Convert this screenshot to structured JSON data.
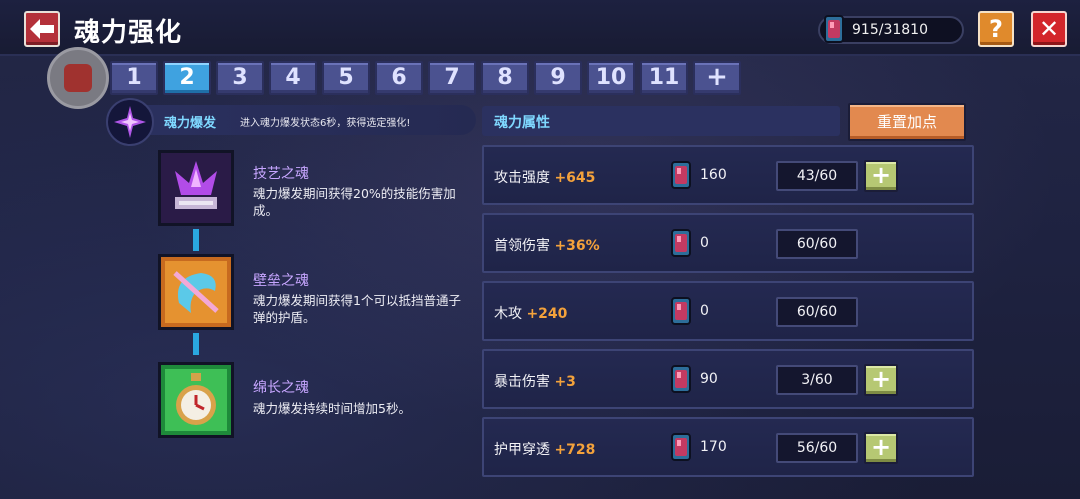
{
  "header": {
    "title": "魂力强化",
    "currency": "915/31810",
    "help_label": "?",
    "close_label": "✕"
  },
  "tabs": [
    "1",
    "2",
    "3",
    "4",
    "5",
    "6",
    "7",
    "8",
    "9",
    "10",
    "11",
    "+"
  ],
  "active_tab": "2",
  "burst": {
    "title": "魂力爆发",
    "description": "进入魂力爆发状态6秒，获得选定强化!"
  },
  "skills": [
    {
      "name": "技艺之魂",
      "description": "魂力爆发期间获得20%的技能伤害加成。",
      "icon": "crystal-icon"
    },
    {
      "name": "壁垒之魂",
      "description": "魂力爆发期间获得1个可以抵挡普通子弹的护盾。",
      "icon": "shield-icon"
    },
    {
      "name": "绵长之魂",
      "description": "魂力爆发持续时间增加5秒。",
      "icon": "clock-icon"
    }
  ],
  "attributes": {
    "title": "魂力属性",
    "reset_label": "重置加点",
    "rows": [
      {
        "name": "攻击强度",
        "bonus": "+645",
        "cost": "160",
        "level": "43/60",
        "can_add": true
      },
      {
        "name": "首领伤害",
        "bonus": "+36%",
        "cost": "0",
        "level": "60/60",
        "can_add": false
      },
      {
        "name": "木攻",
        "bonus": "+240",
        "cost": "0",
        "level": "60/60",
        "can_add": false
      },
      {
        "name": "暴击伤害",
        "bonus": "+3",
        "cost": "90",
        "level": "3/60",
        "can_add": true
      },
      {
        "name": "护甲穿透",
        "bonus": "+728",
        "cost": "170",
        "level": "56/60",
        "can_add": true
      }
    ],
    "plus_label": "+"
  },
  "colors": {
    "accent_blue": "#3fa2e0",
    "bonus_orange": "#f4a23b",
    "skill_name_purple": "#c7a6ff",
    "close_red": "#d3262b",
    "help_orange": "#e08a2c"
  }
}
